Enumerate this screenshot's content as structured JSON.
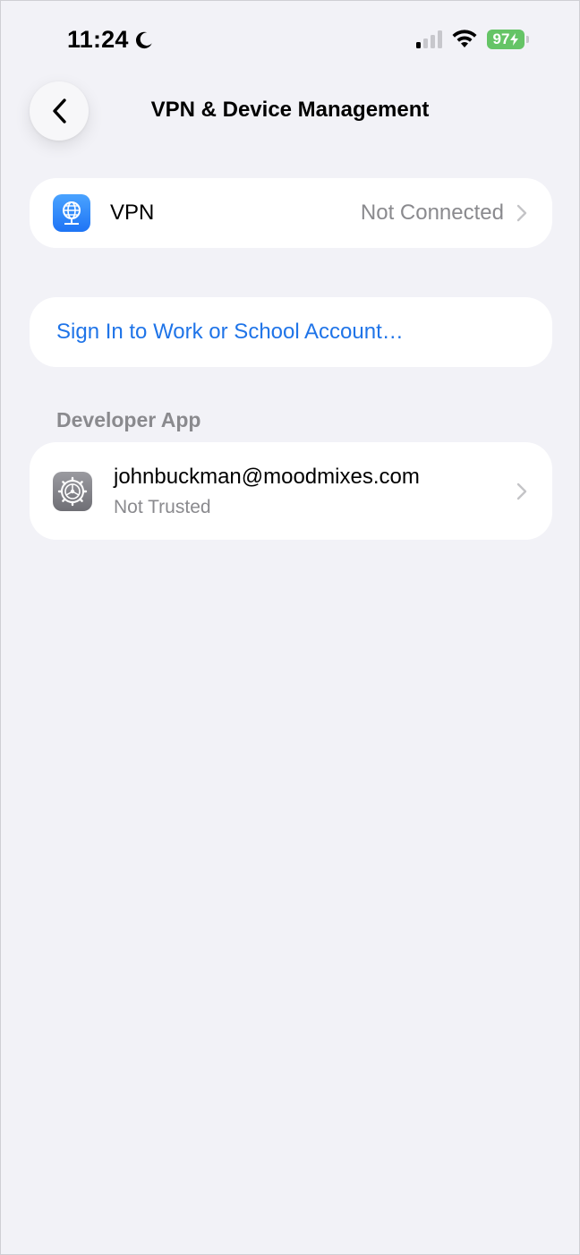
{
  "status_bar": {
    "time": "11:24",
    "battery": "97",
    "icons": [
      "moon-icon",
      "cellular-signal-icon",
      "wifi-icon",
      "battery-charging-icon"
    ]
  },
  "nav": {
    "title": "VPN & Device Management",
    "back_icon": "chevron-left-icon"
  },
  "vpn_row": {
    "label": "VPN",
    "value": "Not Connected",
    "icon": "vpn-globe-icon",
    "icon_color": "#2f86f6"
  },
  "account_row": {
    "label": "Sign In to Work or School Account…",
    "color": "#1f74e8"
  },
  "developer_section": {
    "header": "Developer App",
    "items": [
      {
        "email": "johnbuckman@moodmixes.com",
        "status": "Not Trusted",
        "icon": "settings-gear-icon"
      }
    ]
  },
  "colors": {
    "background": "#f2f2f7",
    "secondary_text": "#8a8a8e",
    "battery": "#65c466"
  }
}
